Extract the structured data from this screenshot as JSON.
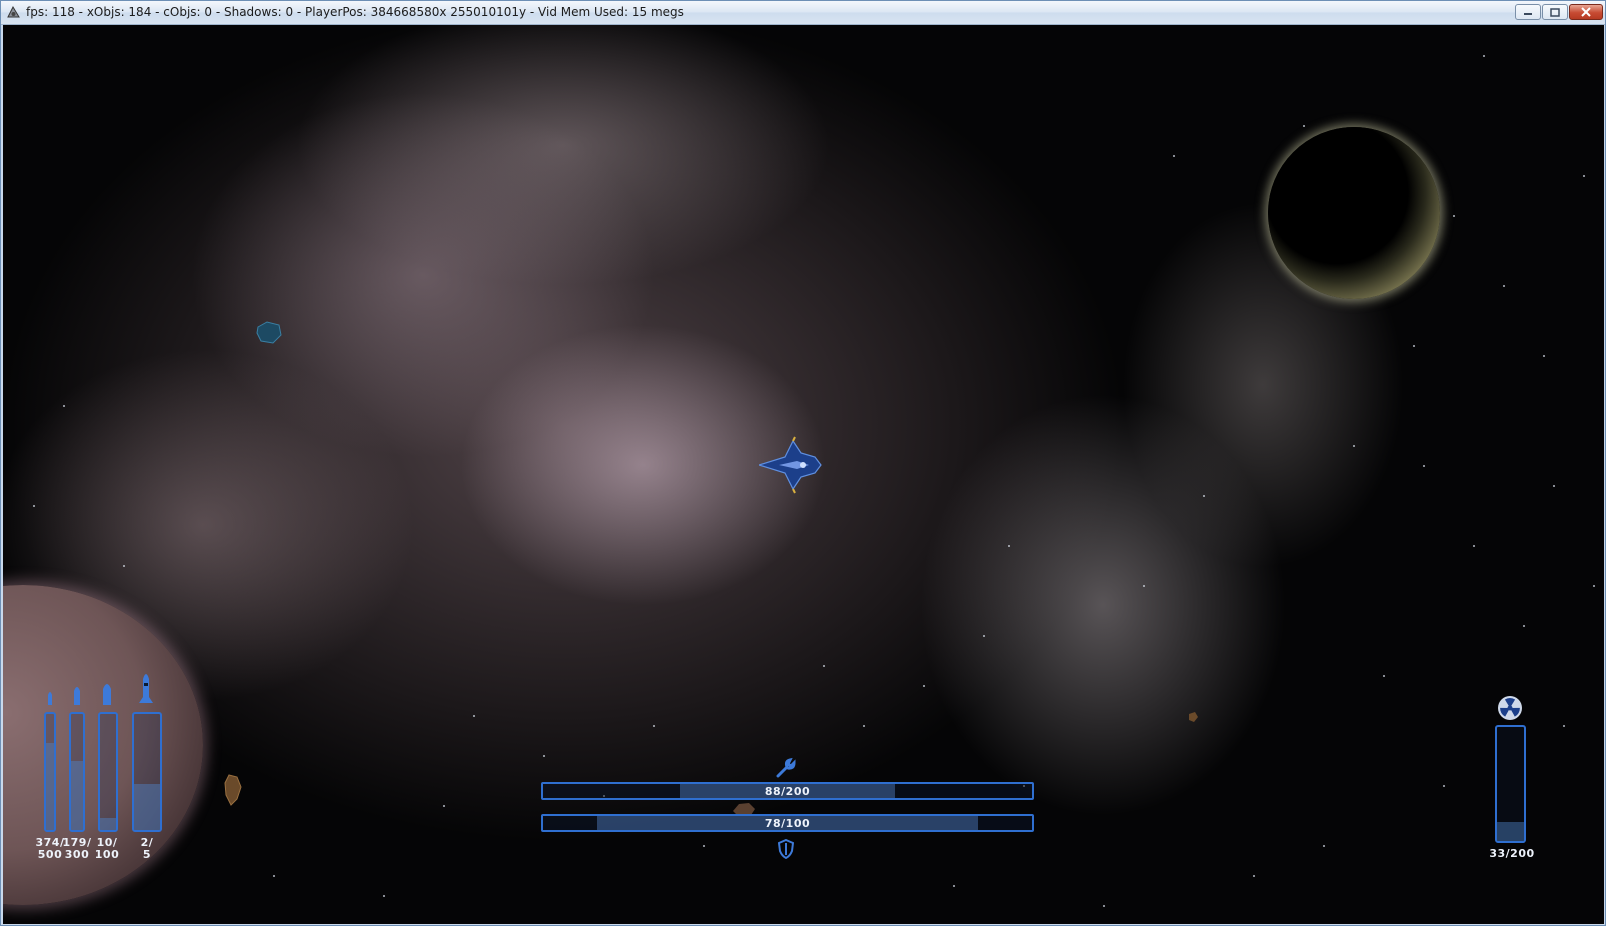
{
  "window": {
    "title": "fps: 118 - xObjs: 184 - cObjs: 0 - Shadows: 0 - PlayerPos: 384668580x 255010101y - Vid Mem Used: 15 megs"
  },
  "hud": {
    "ammo": [
      {
        "line1": "374/",
        "line2": "500",
        "fill": 0.748
      },
      {
        "line1": "179/",
        "line2": "300",
        "fill": 0.597
      },
      {
        "line1": "10/",
        "line2": "100",
        "fill": 0.1
      },
      {
        "line1": "2/",
        "line2": "5",
        "fill": 0.4
      }
    ],
    "repair": {
      "label": "88/200",
      "fill": 0.44
    },
    "shield": {
      "label": "78/100",
      "fill": 0.78
    },
    "radiation": {
      "label": "33/200",
      "fill": 0.165
    }
  },
  "colors": {
    "hud_accent": "#2f6fd0",
    "title_bar": "#dbe6f3",
    "close_button": "#c74b33"
  },
  "icons": [
    "app-icon",
    "minimize-icon",
    "maximize-icon",
    "close-icon",
    "small-bullet-icon",
    "bullet-icon",
    "shell-icon",
    "rocket-icon",
    "wrench-icon",
    "shield-icon",
    "radiation-icon"
  ]
}
